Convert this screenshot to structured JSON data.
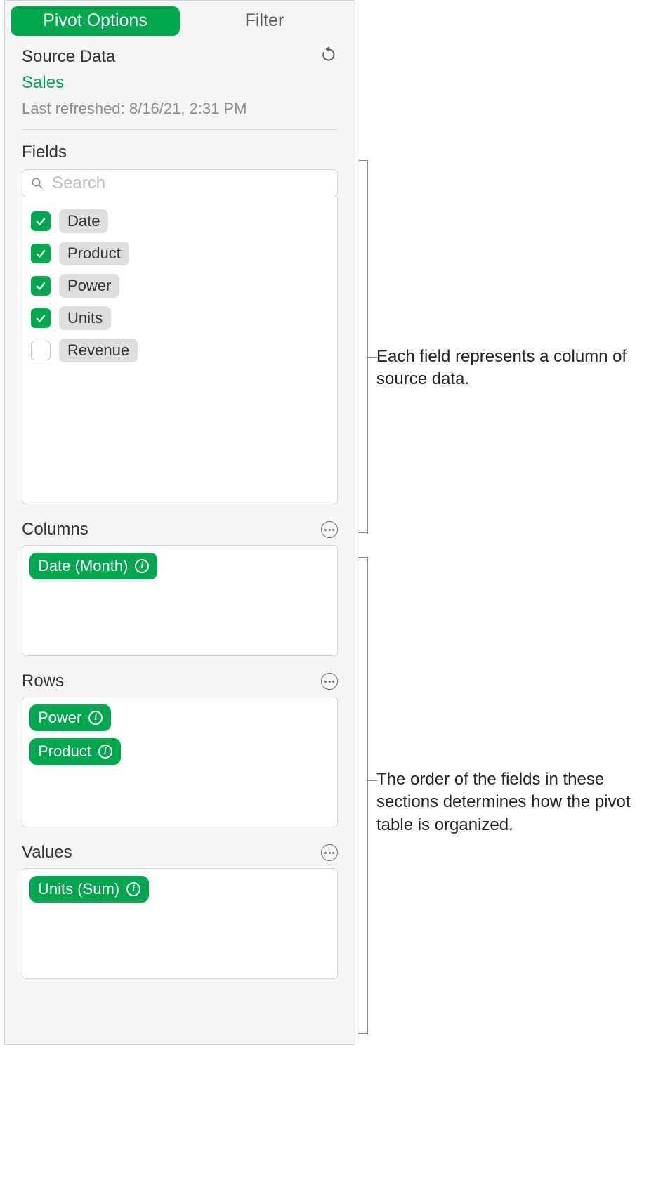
{
  "tabs": {
    "pivot_options": "Pivot Options",
    "filter": "Filter"
  },
  "source_data": {
    "label": "Source Data",
    "name": "Sales",
    "last_refreshed": "Last refreshed: 8/16/21, 2:31 PM"
  },
  "fields": {
    "label": "Fields",
    "search_placeholder": "Search",
    "items": [
      {
        "label": "Date",
        "checked": true
      },
      {
        "label": "Product",
        "checked": true
      },
      {
        "label": "Power",
        "checked": true
      },
      {
        "label": "Units",
        "checked": true
      },
      {
        "label": "Revenue",
        "checked": false
      }
    ]
  },
  "columns": {
    "label": "Columns",
    "items": [
      {
        "label": "Date (Month)"
      }
    ]
  },
  "rows": {
    "label": "Rows",
    "items": [
      {
        "label": "Power"
      },
      {
        "label": "Product"
      }
    ]
  },
  "values": {
    "label": "Values",
    "items": [
      {
        "label": "Units (Sum)"
      }
    ]
  },
  "callouts": {
    "fields": "Each field represents a column of source data.",
    "sections": "The order of the fields in these sections determines how the pivot table is organized."
  }
}
